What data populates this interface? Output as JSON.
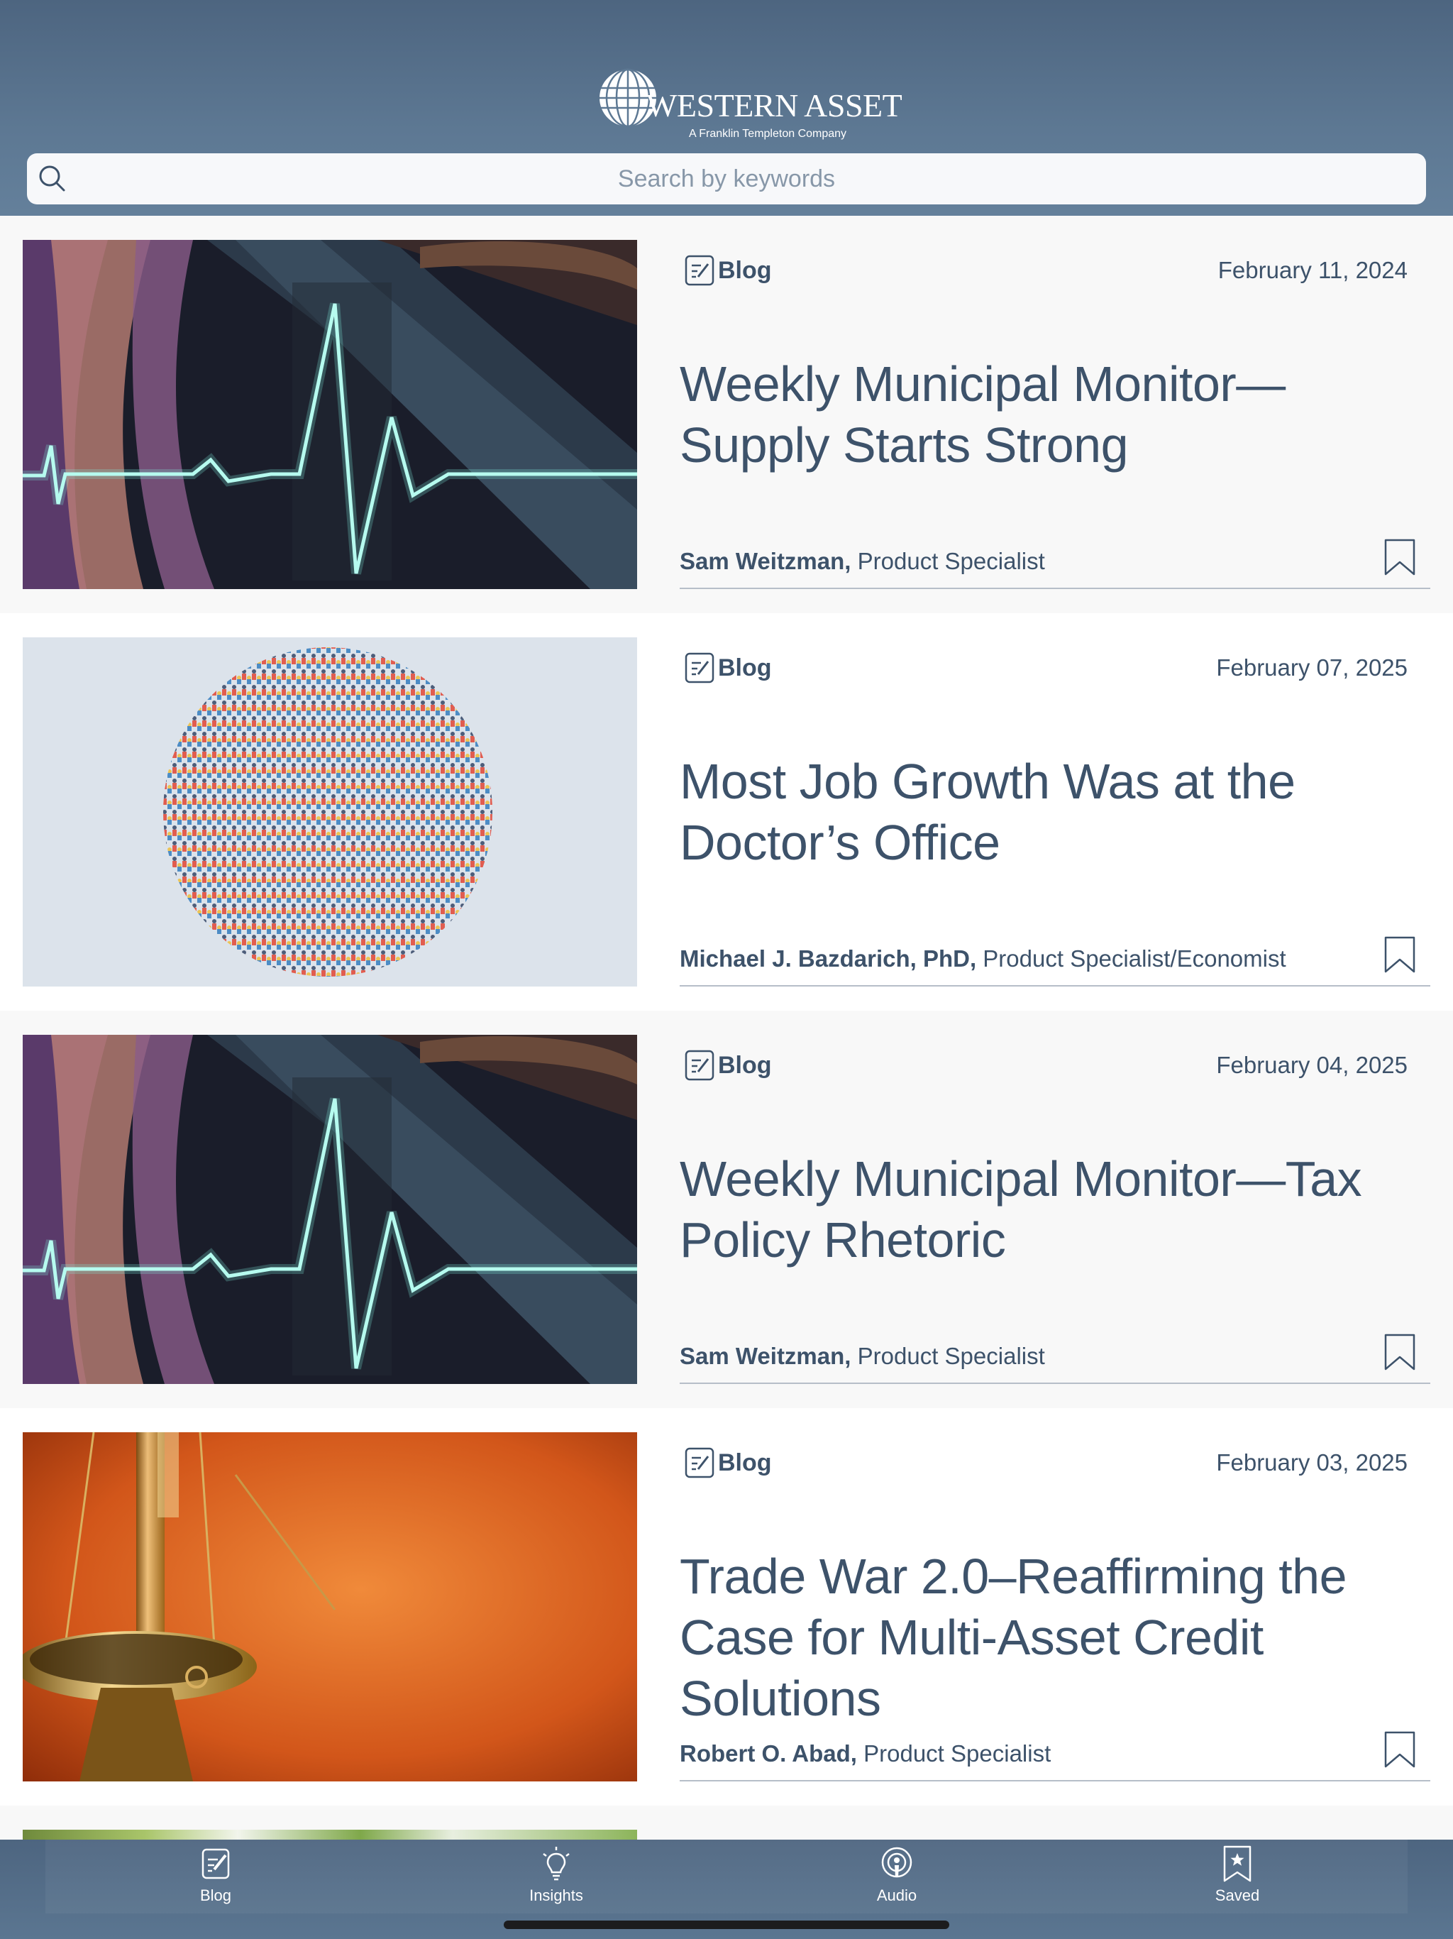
{
  "header": {
    "logo_wordmark": "WESTERN ASSET",
    "logo_tagline": "A Franklin Templeton Company",
    "search_placeholder": "Search by keywords"
  },
  "articles": [
    {
      "category": "Blog",
      "date": "February 11, 2024",
      "title": "Weekly Municipal Monitor—Supply Starts Strong",
      "author": "Sam Weitzman,",
      "role": "Product Specialist",
      "image": "highway-heartbeat"
    },
    {
      "category": "Blog",
      "date": "February 07, 2025",
      "title": "Most Job Growth Was at the Doctor’s Office",
      "author": "Michael J. Bazdarich, PhD,",
      "role": "Product Specialist/Economist",
      "image": "crowd-circle"
    },
    {
      "category": "Blog",
      "date": "February 04, 2025",
      "title": "Weekly Municipal Monitor—Tax Policy Rhetoric",
      "author": "Sam Weitzman,",
      "role": "Product Specialist",
      "image": "highway-heartbeat"
    },
    {
      "category": "Blog",
      "date": "February 03, 2025",
      "title": "Trade War 2.0–Reaffirming the Case for Multi-Asset Credit Solutions",
      "author": "Robert O. Abad,",
      "role": "Product Specialist",
      "image": "balance-scale"
    }
  ],
  "tabs": [
    {
      "label": "Blog",
      "icon": "blog-icon"
    },
    {
      "label": "Insights",
      "icon": "lightbulb-icon"
    },
    {
      "label": "Audio",
      "icon": "podcast-icon"
    },
    {
      "label": "Saved",
      "icon": "bookmark-star-icon"
    }
  ],
  "colors": {
    "header": "#5d7893",
    "text": "#3d526a",
    "card_alt": "#f8f8f8",
    "card_plain": "#ffffff"
  }
}
